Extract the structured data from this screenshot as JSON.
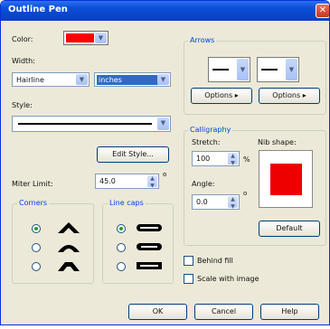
{
  "window": {
    "title": "Outline Pen",
    "close_glyph": "✕"
  },
  "color": {
    "label": "Color:",
    "value": "#ff0000"
  },
  "width": {
    "label": "Width:",
    "size_value": "Hairline",
    "units_value": "inches"
  },
  "style": {
    "label": "Style:"
  },
  "buttons": {
    "edit_style": "Edit Style...",
    "default": "Default",
    "ok": "OK",
    "cancel": "Cancel",
    "help": "Help"
  },
  "miter": {
    "label": "Miter Limit:",
    "value": "45.0",
    "unit": "o"
  },
  "corners": {
    "title": "Corners"
  },
  "line_caps": {
    "title": "Line caps"
  },
  "arrows": {
    "title": "Arrows",
    "options_left": "Options",
    "options_right": "Options"
  },
  "calligraphy": {
    "title": "Calligraphy",
    "stretch_label": "Stretch:",
    "stretch_value": "100",
    "stretch_unit": "%",
    "angle_label": "Angle:",
    "angle_value": "0.0",
    "angle_unit": "o",
    "nib_label": "Nib shape:",
    "nib_color": "#ee0000"
  },
  "options": {
    "behind_fill": "Behind fill",
    "scale_with_image": "Scale with image"
  },
  "icons": {
    "dropdown": "▼",
    "spin_up": "▲",
    "spin_down": "▼",
    "menu_arrow": "▸"
  },
  "colors": {
    "accent": "#0046d5",
    "title_bar": "#0a4fd8",
    "dialog_bg": "#ece9d8"
  }
}
